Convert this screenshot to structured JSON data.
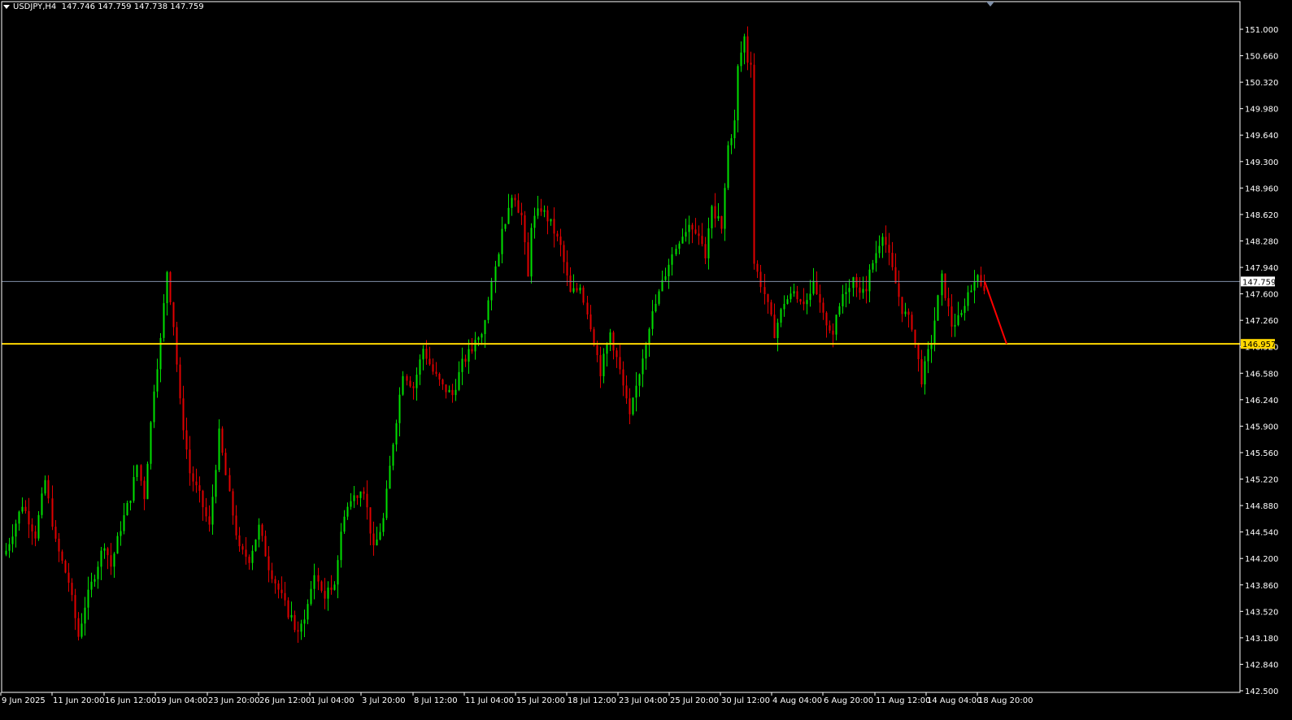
{
  "header": {
    "symbol": "USDJPY,H4",
    "ohlc": "147.746 147.759 147.738 147.759"
  },
  "colors": {
    "background": "#000000",
    "bull": "#00e000",
    "bear": "#e00000",
    "axis": "#ffffff",
    "current_price_line": "#8090a8",
    "support_line": "#ffd700",
    "arrow": "#ff0000"
  },
  "chart_data": {
    "type": "candlestick",
    "y_ticks": [
      "151.000",
      "150.660",
      "150.320",
      "149.980",
      "149.640",
      "149.300",
      "148.960",
      "148.620",
      "148.280",
      "147.940",
      "147.600",
      "147.260",
      "146.920",
      "146.580",
      "146.240",
      "145.900",
      "145.560",
      "145.220",
      "144.880",
      "144.540",
      "144.200",
      "143.860",
      "143.520",
      "143.180",
      "142.840",
      "142.500"
    ],
    "x_ticks": [
      "9 Jun 2025",
      "11 Jun 20:00",
      "16 Jun 12:00",
      "19 Jun 04:00",
      "23 Jun 20:00",
      "26 Jun 12:00",
      "1 Jul 04:00",
      "3 Jul 20:00",
      "8 Jul 12:00",
      "11 Jul 04:00",
      "15 Jul 20:00",
      "18 Jul 12:00",
      "23 Jul 04:00",
      "25 Jul 20:00",
      "30 Jul 12:00",
      "4 Aug 04:00",
      "6 Aug 20:00",
      "11 Aug 12:00",
      "14 Aug 04:00",
      "18 Aug 20:00"
    ],
    "ylim": [
      142.5,
      151.0
    ],
    "current_price": 147.759,
    "current_price_label": "147.759",
    "support_level": 146.957,
    "support_label": "146.957",
    "arrow": {
      "from_price": 147.759,
      "to_price": 146.957,
      "direction": "down"
    },
    "path": [
      [
        0,
        144.3
      ],
      [
        5,
        144.9
      ],
      [
        9,
        144.5
      ],
      [
        12,
        145.2
      ],
      [
        15,
        144.4
      ],
      [
        19,
        143.9
      ],
      [
        22,
        143.2
      ],
      [
        24,
        143.6
      ],
      [
        27,
        144.0
      ],
      [
        30,
        144.4
      ],
      [
        32,
        144.1
      ],
      [
        35,
        144.6
      ],
      [
        38,
        145.0
      ],
      [
        40,
        145.4
      ],
      [
        42,
        145.0
      ],
      [
        45,
        146.4
      ],
      [
        47,
        147.0
      ],
      [
        49,
        147.9
      ],
      [
        51,
        147.2
      ],
      [
        53,
        146.2
      ],
      [
        56,
        145.3
      ],
      [
        59,
        145.0
      ],
      [
        62,
        144.6
      ],
      [
        65,
        145.8
      ],
      [
        68,
        145.0
      ],
      [
        71,
        144.3
      ],
      [
        74,
        144.2
      ],
      [
        77,
        144.6
      ],
      [
        80,
        144.1
      ],
      [
        83,
        143.8
      ],
      [
        86,
        143.5
      ],
      [
        89,
        143.2
      ],
      [
        92,
        143.6
      ],
      [
        94,
        144.0
      ],
      [
        97,
        143.7
      ],
      [
        100,
        143.9
      ],
      [
        103,
        144.8
      ],
      [
        106,
        145.0
      ],
      [
        109,
        145.1
      ],
      [
        112,
        144.3
      ],
      [
        115,
        144.7
      ],
      [
        118,
        145.7
      ],
      [
        121,
        146.6
      ],
      [
        124,
        146.4
      ],
      [
        127,
        146.9
      ],
      [
        130,
        146.6
      ],
      [
        133,
        146.4
      ],
      [
        136,
        146.3
      ],
      [
        139,
        146.7
      ],
      [
        142,
        146.9
      ],
      [
        145,
        147.1
      ],
      [
        148,
        147.7
      ],
      [
        151,
        148.4
      ],
      [
        154,
        148.9
      ],
      [
        157,
        148.6
      ],
      [
        159,
        147.8
      ],
      [
        160,
        148.5
      ],
      [
        163,
        148.7
      ],
      [
        166,
        148.5
      ],
      [
        169,
        148.2
      ],
      [
        172,
        147.6
      ],
      [
        175,
        147.7
      ],
      [
        178,
        147.2
      ],
      [
        181,
        146.6
      ],
      [
        184,
        147.1
      ],
      [
        187,
        146.6
      ],
      [
        190,
        146.0
      ],
      [
        193,
        146.6
      ],
      [
        196,
        147.2
      ],
      [
        199,
        147.6
      ],
      [
        202,
        148.0
      ],
      [
        205,
        148.3
      ],
      [
        208,
        148.5
      ],
      [
        211,
        148.4
      ],
      [
        213,
        148.1
      ],
      [
        215,
        148.7
      ],
      [
        218,
        148.4
      ],
      [
        220,
        149.5
      ],
      [
        222,
        149.8
      ],
      [
        223,
        150.5
      ],
      [
        225,
        150.9
      ],
      [
        226,
        150.6
      ],
      [
        227,
        150.6
      ],
      [
        228,
        148.0
      ],
      [
        231,
        147.6
      ],
      [
        234,
        147.1
      ],
      [
        237,
        147.5
      ],
      [
        240,
        147.6
      ],
      [
        243,
        147.5
      ],
      [
        246,
        147.7
      ],
      [
        249,
        147.3
      ],
      [
        252,
        147.1
      ],
      [
        255,
        147.6
      ],
      [
        258,
        147.8
      ],
      [
        261,
        147.6
      ],
      [
        264,
        148.0
      ],
      [
        267,
        148.4
      ],
      [
        270,
        147.9
      ],
      [
        273,
        147.4
      ],
      [
        276,
        147.2
      ],
      [
        279,
        146.5
      ],
      [
        282,
        147.0
      ],
      [
        285,
        147.8
      ],
      [
        288,
        147.2
      ],
      [
        291,
        147.3
      ],
      [
        294,
        147.7
      ],
      [
        296,
        147.8
      ],
      [
        298,
        147.7
      ]
    ]
  }
}
